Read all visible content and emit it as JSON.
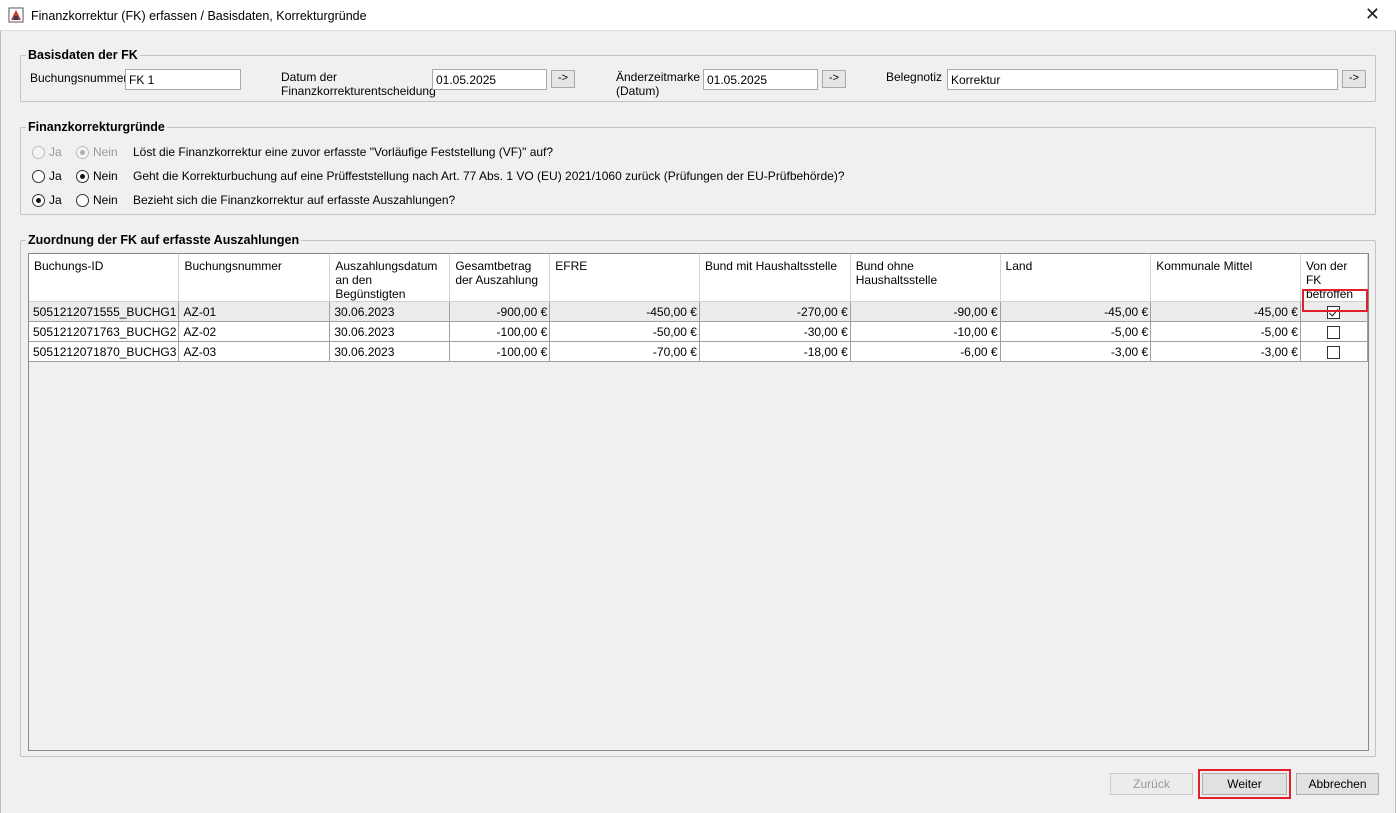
{
  "window": {
    "title": "Finanzkorrektur (FK) erfassen / Basisdaten, Korrekturgründe",
    "close_glyph": "✕"
  },
  "basisdaten": {
    "group_title": "Basisdaten der FK",
    "buchungsnummer_label": "Buchungsnummer",
    "buchungsnummer_value": "FK 1",
    "datum_label_1": "Datum der",
    "datum_label_2": "Finanzkorrekturentscheidung",
    "datum_value": "01.05.2025",
    "aenderung_label_1": "Änderzeitmarke",
    "aenderung_label_2": "(Datum)",
    "aenderung_value": "01.05.2025",
    "belegnotiz_label": "Belegnotiz",
    "belegnotiz_value": "Korrektur",
    "arrow_label": "->"
  },
  "gruende": {
    "group_title": "Finanzkorrekturgründe",
    "ja_label": "Ja",
    "nein_label": "Nein",
    "questions": [
      {
        "text": "Löst die Finanzkorrektur eine zuvor erfasste \"Vorläufige Feststellung (VF)\" auf?",
        "selected": "Nein",
        "disabled": true
      },
      {
        "text": "Geht die Korrekturbuchung auf eine Prüffeststellung nach Art. 77 Abs. 1 VO (EU) 2021/1060 zurück (Prüfungen der EU-Prüfbehörde)?",
        "selected": "Nein",
        "disabled": false
      },
      {
        "text": "Bezieht sich die Finanzkorrektur auf erfasste Auszahlungen?",
        "selected": "Ja",
        "disabled": false
      }
    ]
  },
  "zuordnung": {
    "group_title": "Zuordnung der FK auf erfasste Auszahlungen",
    "columns": [
      "Buchungs-ID",
      "Buchungsnummer",
      "Auszahlungsdatum an den Begünstigten",
      "Gesamtbetrag der Auszahlung",
      "EFRE",
      "Bund mit Haushaltsstelle",
      "Bund ohne Haushaltsstelle",
      "Land",
      "Kommunale Mittel",
      "Von der FK betroffen"
    ],
    "rows": [
      {
        "id": "5051212071555_BUCHG1",
        "nr": "AZ-01",
        "datum": "30.06.2023",
        "gesamt": "-900,00 €",
        "efre": "-450,00 €",
        "bund_mit": "-270,00 €",
        "bund_ohne": "-90,00 €",
        "land": "-45,00 €",
        "kommunal": "-45,00 €",
        "checked": true
      },
      {
        "id": "5051212071763_BUCHG2",
        "nr": "AZ-02",
        "datum": "30.06.2023",
        "gesamt": "-100,00 €",
        "efre": "-50,00 €",
        "bund_mit": "-30,00 €",
        "bund_ohne": "-10,00 €",
        "land": "-5,00 €",
        "kommunal": "-5,00 €",
        "checked": false
      },
      {
        "id": "5051212071870_BUCHG3",
        "nr": "AZ-03",
        "datum": "30.06.2023",
        "gesamt": "-100,00 €",
        "efre": "-70,00 €",
        "bund_mit": "-18,00 €",
        "bund_ohne": "-6,00 €",
        "land": "-3,00 €",
        "kommunal": "-3,00 €",
        "checked": false
      }
    ]
  },
  "buttons": {
    "zurueck": "Zurück",
    "weiter": "Weiter",
    "abbrechen": "Abbrechen"
  },
  "colors": {
    "highlight": "#e0202a",
    "background": "#f0f0f0"
  }
}
